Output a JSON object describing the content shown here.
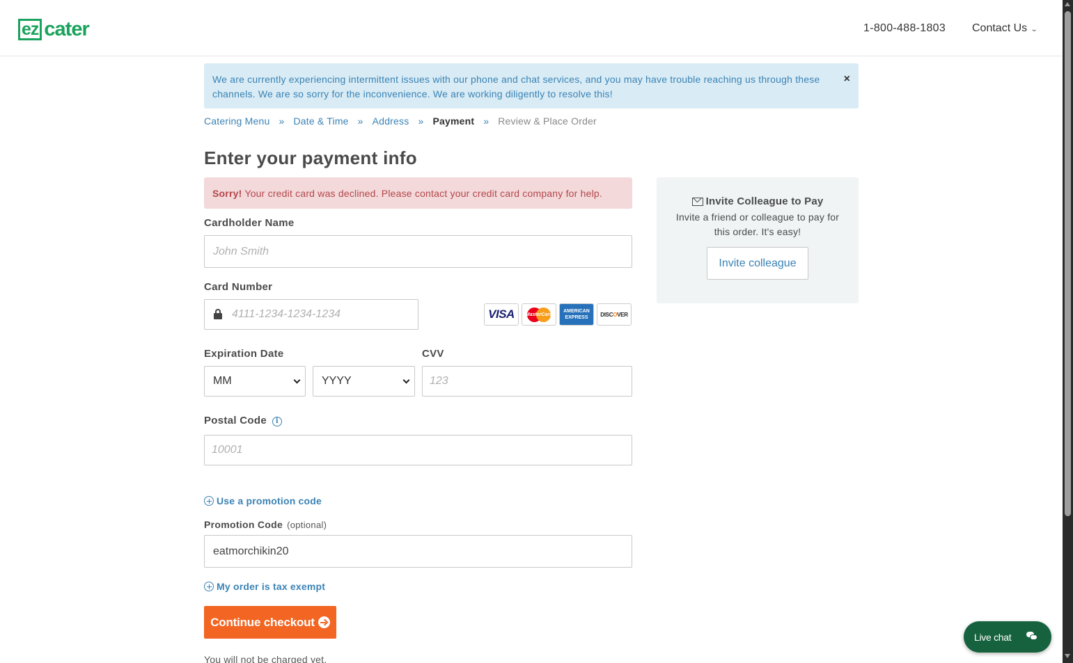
{
  "header": {
    "logo_ez": "ez",
    "logo_cater": "cater",
    "phone": "1-800-488-1803",
    "contact_label": "Contact Us"
  },
  "alert": {
    "message": "We are currently experiencing intermittent issues with our phone and chat services, and you may have trouble reaching us through these channels. We are so sorry for the inconvenience. We are working diligently to resolve this!",
    "close_symbol": "×"
  },
  "breadcrumb": {
    "items": [
      {
        "label": "Catering Menu",
        "state": "link"
      },
      {
        "label": "Date & Time",
        "state": "link"
      },
      {
        "label": "Address",
        "state": "link"
      },
      {
        "label": "Payment",
        "state": "current"
      },
      {
        "label": "Review & Place Order",
        "state": "future"
      }
    ],
    "separator": "»"
  },
  "page_title": "Enter your payment info",
  "error": {
    "strong": "Sorry!",
    "message": "Your credit card was declined. Please contact your credit card company for help."
  },
  "form": {
    "cardholder_label": "Cardholder Name",
    "cardholder_placeholder": "John Smith",
    "card_number_label": "Card Number",
    "card_number_placeholder": "4111-1234-1234-1234",
    "cards": {
      "visa": "VISA",
      "mastercard": "MasterCard",
      "amex_line1": "AMERICAN",
      "amex_line2": "EXPRESS",
      "discover_a": "DISC",
      "discover_o": "O",
      "discover_b": "VER"
    },
    "expiration_label": "Expiration Date",
    "month_value": "MM",
    "year_value": "YYYY",
    "cvv_label": "CVV",
    "cvv_placeholder": "123",
    "postal_label": "Postal Code",
    "postal_placeholder": "10001",
    "info_symbol": "i",
    "promo_toggle": "Use a promotion code",
    "promo_label": "Promotion Code",
    "promo_optional": "(optional)",
    "promo_value": "eatmorchikin20",
    "tax_exempt_toggle": "My order is tax exempt",
    "continue_label": "Continue checkout",
    "note": "You will not be charged yet."
  },
  "invite": {
    "title": "Invite Colleague to Pay",
    "description": "Invite a friend or colleague to pay for this order. It's easy!",
    "button": "Invite colleague"
  },
  "live_chat": {
    "label": "Live chat"
  },
  "colors": {
    "brand_green": "#1aa35c",
    "link_blue": "#3a82b4",
    "cta_orange": "#f26522",
    "error_bg": "#f3d9da",
    "alert_bg": "#d9ecf5",
    "chat_green": "#16623e"
  }
}
